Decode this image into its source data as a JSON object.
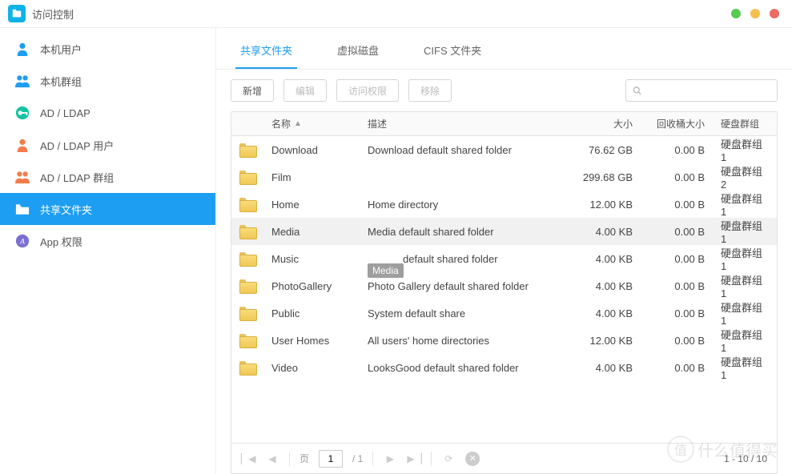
{
  "window": {
    "title": "访问控制"
  },
  "sidebar": {
    "items": [
      {
        "label": "本机用户",
        "icon": "user",
        "color": "#1e9ef3"
      },
      {
        "label": "本机群组",
        "icon": "group",
        "color": "#1e9ef3"
      },
      {
        "label": "AD / LDAP",
        "icon": "key",
        "color": "#13c3a2"
      },
      {
        "label": "AD / LDAP 用户",
        "icon": "user",
        "color": "#f47c4c"
      },
      {
        "label": "AD / LDAP 群组",
        "icon": "group",
        "color": "#f47c4c"
      },
      {
        "label": "共享文件夹",
        "icon": "folder",
        "color": "#ffffff"
      },
      {
        "label": "App 权限",
        "icon": "app",
        "color": "#7b6fd0"
      }
    ],
    "activeIndex": 5
  },
  "tabs": {
    "items": [
      "共享文件夹",
      "虚拟磁盘",
      "CIFS 文件夹"
    ],
    "activeIndex": 0
  },
  "toolbar": {
    "add": "新增",
    "edit": "编辑",
    "access": "访问权限",
    "remove": "移除",
    "searchPlaceholder": ""
  },
  "table": {
    "columns": {
      "name": "名称",
      "desc": "描述",
      "size": "大小",
      "recycle": "回收桶大小",
      "disk": "硬盘群组"
    },
    "selectedIndex": 3,
    "rows": [
      {
        "name": "Download",
        "desc": "Download default shared folder",
        "size": "76.62 GB",
        "recycle": "0.00 B",
        "disk": "硬盘群组 1"
      },
      {
        "name": "Film",
        "desc": "",
        "size": "299.68 GB",
        "recycle": "0.00 B",
        "disk": "硬盘群组 2"
      },
      {
        "name": "Home",
        "desc": "Home directory",
        "size": "12.00 KB",
        "recycle": "0.00 B",
        "disk": "硬盘群组 1"
      },
      {
        "name": "Media",
        "desc": "Media default shared folder",
        "size": "4.00 KB",
        "recycle": "0.00 B",
        "disk": "硬盘群组 1"
      },
      {
        "name": "Music",
        "desc": "default shared folder",
        "size": "4.00 KB",
        "recycle": "0.00 B",
        "disk": "硬盘群组 1"
      },
      {
        "name": "PhotoGallery",
        "desc": "Photo Gallery default shared folder",
        "size": "4.00 KB",
        "recycle": "0.00 B",
        "disk": "硬盘群组 1"
      },
      {
        "name": "Public",
        "desc": "System default share",
        "size": "4.00 KB",
        "recycle": "0.00 B",
        "disk": "硬盘群组 1"
      },
      {
        "name": "User Homes",
        "desc": "All users' home directories",
        "size": "12.00 KB",
        "recycle": "0.00 B",
        "disk": "硬盘群组 1"
      },
      {
        "name": "Video",
        "desc": "LooksGood default shared folder",
        "size": "4.00 KB",
        "recycle": "0.00 B",
        "disk": "硬盘群组 1"
      }
    ],
    "tooltip": {
      "rowIndex": 4,
      "text": "Media"
    }
  },
  "pager": {
    "pageLabel": "页",
    "page": "1",
    "totalPages": "/ 1",
    "range": "1 - 10 / 10"
  },
  "watermark": "什么值得买"
}
